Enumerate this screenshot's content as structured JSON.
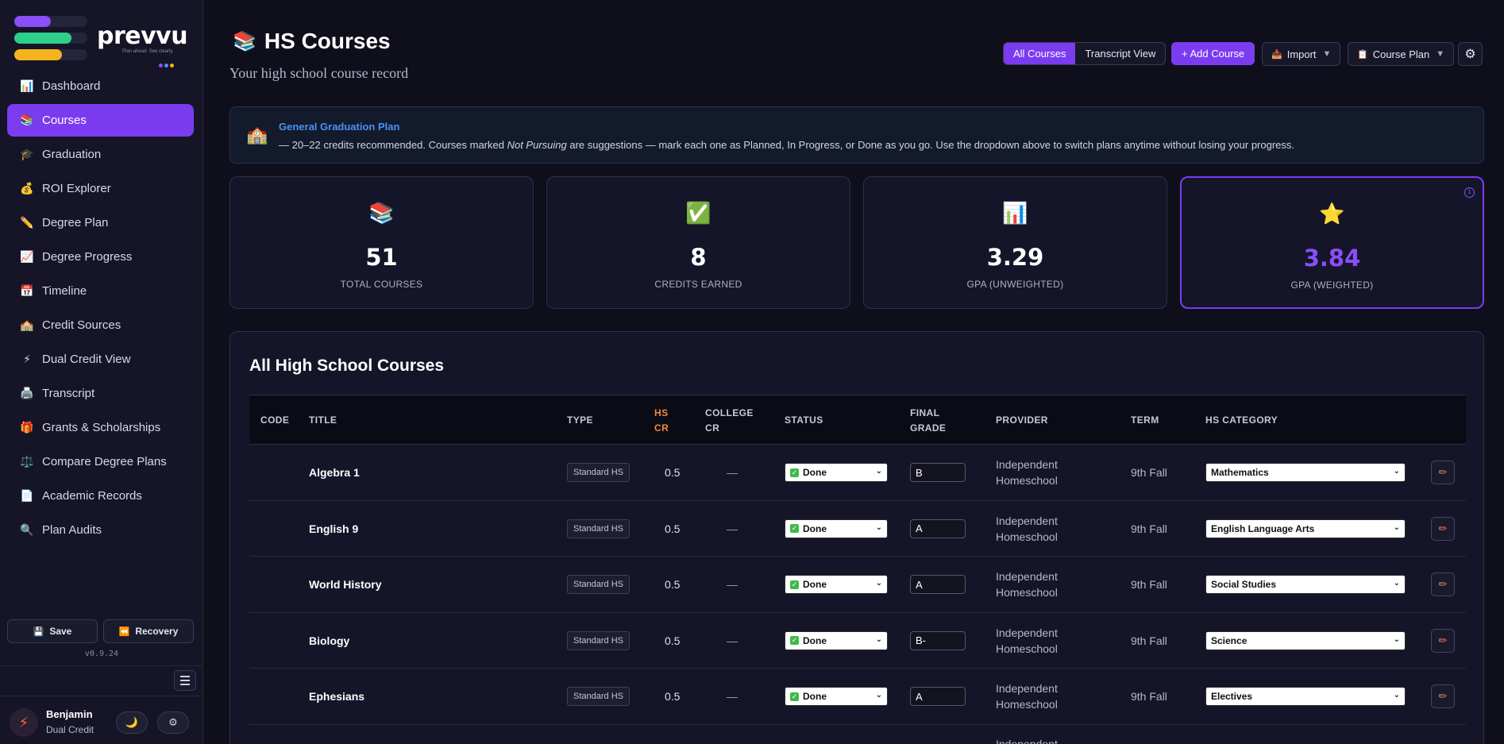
{
  "app": {
    "logo_word": "prevvu",
    "logo_tagline": "Plan ahead. See clearly.",
    "version": "v0.9.24"
  },
  "colors": {
    "accent": "#7b3cf0",
    "logo_bar_1": "#8b4ef7",
    "logo_bar_2": "#2ecf8a",
    "logo_bar_3": "#f5b31f",
    "banner_title": "#4d8ff5",
    "hs_cr_header": "#f08a3a",
    "status_done": "#3dbb4a"
  },
  "sidebar": {
    "items": [
      {
        "label": "Dashboard",
        "icon": "bar-chart-icon",
        "glyph": "📊",
        "active": false
      },
      {
        "label": "Courses",
        "icon": "books-icon",
        "glyph": "📚",
        "active": true
      },
      {
        "label": "Graduation",
        "icon": "graduation-cap-icon",
        "glyph": "🎓",
        "active": false
      },
      {
        "label": "ROI Explorer",
        "icon": "money-bag-icon",
        "glyph": "💰",
        "active": false
      },
      {
        "label": "Degree Plan",
        "icon": "pencil-icon",
        "glyph": "✏️",
        "active": false
      },
      {
        "label": "Degree Progress",
        "icon": "trend-chart-icon",
        "glyph": "📈",
        "active": false
      },
      {
        "label": "Timeline",
        "icon": "calendar-icon",
        "glyph": "📅",
        "active": false
      },
      {
        "label": "Credit Sources",
        "icon": "school-icon",
        "glyph": "🏫",
        "active": false
      },
      {
        "label": "Dual Credit View",
        "icon": "lightning-icon",
        "glyph": "⚡",
        "active": false
      },
      {
        "label": "Transcript",
        "icon": "printer-icon",
        "glyph": "🖨️",
        "active": false
      },
      {
        "label": "Grants & Scholarships",
        "icon": "gift-icon",
        "glyph": "🎁",
        "active": false
      },
      {
        "label": "Compare Degree Plans",
        "icon": "balance-scale-icon",
        "glyph": "⚖️",
        "active": false
      },
      {
        "label": "Academic Records",
        "icon": "document-icon",
        "glyph": "📄",
        "active": false
      },
      {
        "label": "Plan Audits",
        "icon": "magnifier-icon",
        "glyph": "🔍",
        "active": false
      }
    ],
    "save_label": "Save",
    "recovery_label": "Recovery",
    "user": {
      "name": "Benjamin",
      "role": "Dual Credit"
    }
  },
  "header": {
    "title": "HS Courses",
    "subtitle": "Your high school course record",
    "view_all": "All Courses",
    "view_transcript": "Transcript View",
    "add_course": "+ Add Course",
    "import_label": "Import",
    "course_plan_label": "Course Plan"
  },
  "banner": {
    "title": "General Graduation Plan",
    "text_before": "— 20–22 credits recommended. Courses marked ",
    "text_em": "Not Pursuing",
    "text_after": " are suggestions — mark each one as Planned, In Progress, or Done as you go. Use the dropdown above to switch plans anytime without losing your progress."
  },
  "stats": [
    {
      "value": "51",
      "label": "TOTAL COURSES",
      "icon": "books-icon",
      "glyph": "📚"
    },
    {
      "value": "8",
      "label": "CREDITS EARNED",
      "icon": "check-mark-icon",
      "glyph": "✅"
    },
    {
      "value": "3.29",
      "label": "GPA (UNWEIGHTED)",
      "icon": "bar-chart-icon",
      "glyph": "📊"
    },
    {
      "value": "3.84",
      "label": "GPA (WEIGHTED)",
      "icon": "star-icon",
      "glyph": "⭐"
    }
  ],
  "table": {
    "title": "All High School Courses",
    "headers": {
      "code": "CODE",
      "title": "TITLE",
      "type": "TYPE",
      "hs_cr_1": "HS",
      "hs_cr_2": "CR",
      "college_cr_1": "COLLEGE",
      "college_cr_2": "CR",
      "status": "STATUS",
      "final_grade_1": "FINAL",
      "final_grade_2": "GRADE",
      "provider": "PROVIDER",
      "term": "TERM",
      "hs_category": "HS CATEGORY"
    },
    "rows": [
      {
        "code": "",
        "title": "Algebra 1",
        "type": "Standard HS",
        "hs_cr": "0.5",
        "college_cr": "—",
        "status": "Done",
        "grade": "B",
        "provider_1": "Independent",
        "provider_2": "Homeschool",
        "term": "9th Fall",
        "category": "Mathematics"
      },
      {
        "code": "",
        "title": "English 9",
        "type": "Standard HS",
        "hs_cr": "0.5",
        "college_cr": "—",
        "status": "Done",
        "grade": "A",
        "provider_1": "Independent",
        "provider_2": "Homeschool",
        "term": "9th Fall",
        "category": "English Language Arts"
      },
      {
        "code": "",
        "title": "World History",
        "type": "Standard HS",
        "hs_cr": "0.5",
        "college_cr": "—",
        "status": "Done",
        "grade": "A",
        "provider_1": "Independent",
        "provider_2": "Homeschool",
        "term": "9th Fall",
        "category": "Social Studies"
      },
      {
        "code": "",
        "title": "Biology",
        "type": "Standard HS",
        "hs_cr": "0.5",
        "college_cr": "—",
        "status": "Done",
        "grade": "B-",
        "provider_1": "Independent",
        "provider_2": "Homeschool",
        "term": "9th Fall",
        "category": "Science"
      },
      {
        "code": "",
        "title": "Ephesians",
        "type": "Standard HS",
        "hs_cr": "0.5",
        "college_cr": "—",
        "status": "Done",
        "grade": "A",
        "provider_1": "Independent",
        "provider_2": "Homeschool",
        "term": "9th Fall",
        "category": "Electives"
      },
      {
        "code": "",
        "title": "",
        "type": "",
        "hs_cr": "",
        "college_cr": "",
        "status": "",
        "grade": "",
        "provider_1": "Independent",
        "provider_2": "",
        "term": "",
        "category": ""
      }
    ]
  }
}
